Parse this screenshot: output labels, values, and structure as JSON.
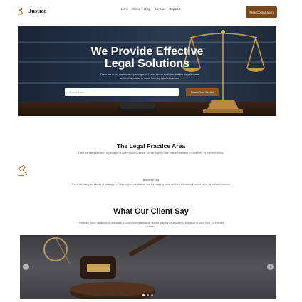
{
  "header": {
    "logo_text": "Justice",
    "nav": [
      "Home",
      "About",
      "Blog",
      "Contact",
      "Support"
    ],
    "cta_label": "Free Consultation"
  },
  "hero": {
    "title_line1": "We Provide Effective",
    "title_line2": "Legal Solutions",
    "subtitle": "There are many variations of passages of Lorem Ipsum available, but the majority have suffered alteration in some form, by injected humour",
    "search_placeholder": "Search Here",
    "search_button": "Search Your Service"
  },
  "practice": {
    "title": "The Legal Practice Area",
    "description": "There are many variations of passages of Lorem Ipsum available, but the majority have suffered alteration in some form, by injected humour.",
    "item_title": "Business Law",
    "item_description": "There are many variations of passages of Lorem Ipsum available, but the majority have suffered alteration in some form, by injected humour."
  },
  "clients": {
    "title": "What Our Client Say",
    "description": "There are many variations of passages of Lorem Ipsum available, but the majority have suffered alteration in some form, by injected humour.",
    "prev_label": "‹",
    "next_label": "›"
  },
  "colors": {
    "accent": "#7a4a1e",
    "hero_bg": "#1e2a3a"
  }
}
